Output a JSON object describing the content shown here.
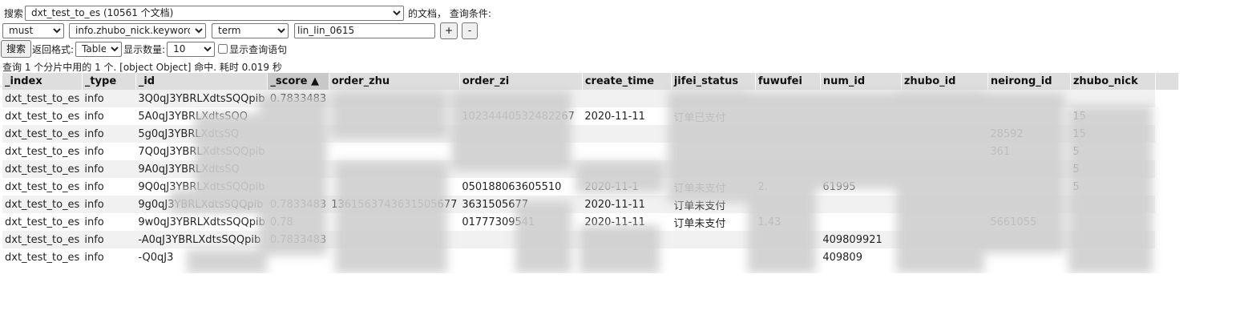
{
  "search": {
    "label": "搜索",
    "index_selected": "dxt_test_to_es (10561 个文档)",
    "suffix": "的文档， 查询条件:"
  },
  "query": {
    "bool_selected": "must",
    "field_selected": "info.zhubo_nick.keyword",
    "op_selected": "term",
    "value": "lin_lin_0615",
    "add_label": "+",
    "remove_label": "-"
  },
  "controls": {
    "search_button": "搜索",
    "format_label": "返回格式:",
    "format_selected": "Table",
    "count_label": "显示数量:",
    "count_selected": "10",
    "show_query_label": "显示查询语句"
  },
  "status": "查询 1 个分片中用的 1 个. [object Object] 命中. 耗时 0.019 秒",
  "table": {
    "columns": [
      "_index",
      "_type",
      "_id",
      "_score ▲",
      "order_zhu",
      "order_zi",
      "create_time",
      "jifei_status",
      "fuwufei",
      "num_id",
      "zhubo_id",
      "neirong_id",
      "zhubo_nick"
    ],
    "rows": [
      [
        "dxt_test_to_es",
        "info",
        "3Q0qJ3YBRLXdtsSQQpib",
        "0.7833483",
        "",
        "",
        "",
        "",
        "",
        "",
        "",
        "",
        ""
      ],
      [
        "dxt_test_to_es",
        "info",
        "5A0qJ3YBRLXdtsSQQ",
        "",
        "",
        "10234440532482267",
        "2020-11-11",
        "订单已支付",
        "",
        "",
        "",
        "",
        "15"
      ],
      [
        "dxt_test_to_es",
        "info",
        "5g0qJ3YBRLXdtsSQ",
        "",
        "",
        "",
        "",
        "",
        "",
        "",
        "",
        "28592",
        "15"
      ],
      [
        "dxt_test_to_es",
        "info",
        "7Q0qJ3YBRLXdtsSQQpib",
        "",
        "",
        "",
        "",
        "",
        "",
        "",
        "",
        "361",
        "5"
      ],
      [
        "dxt_test_to_es",
        "info",
        "9A0qJ3YBRLXdtsSQ",
        "",
        "",
        "",
        "",
        "",
        "",
        "",
        "",
        "",
        "5"
      ],
      [
        "dxt_test_to_es",
        "info",
        "9Q0qJ3YBRLXdtsSQQpib",
        "",
        "",
        "050188063605510",
        "2020-11-1",
        "订单未支付",
        "2.",
        "61995",
        "",
        "",
        "5"
      ],
      [
        "dxt_test_to_es",
        "info",
        "9g0qJ3YBRLXdtsSQQpib",
        "0.7833483",
        "1361563743631505677",
        "3631505677",
        "2020-11-11",
        "订单未支付",
        "",
        "",
        "",
        "",
        ""
      ],
      [
        "dxt_test_to_es",
        "info",
        "9w0qJ3YBRLXdtsSQQpib",
        "0.78",
        "",
        "01777309541",
        "2020-11-11",
        "订单未支付",
        "1.43",
        "",
        "",
        "5661055",
        ""
      ],
      [
        "dxt_test_to_es",
        "info",
        "-A0qJ3YBRLXdtsSQQpib",
        "0.7833483",
        "",
        "",
        "",
        "",
        "",
        "409809921",
        "",
        "",
        ""
      ],
      [
        "dxt_test_to_es",
        "info",
        "-Q0qJ3",
        "",
        "",
        "",
        "",
        "",
        "",
        "409809",
        "",
        "",
        ""
      ]
    ]
  }
}
